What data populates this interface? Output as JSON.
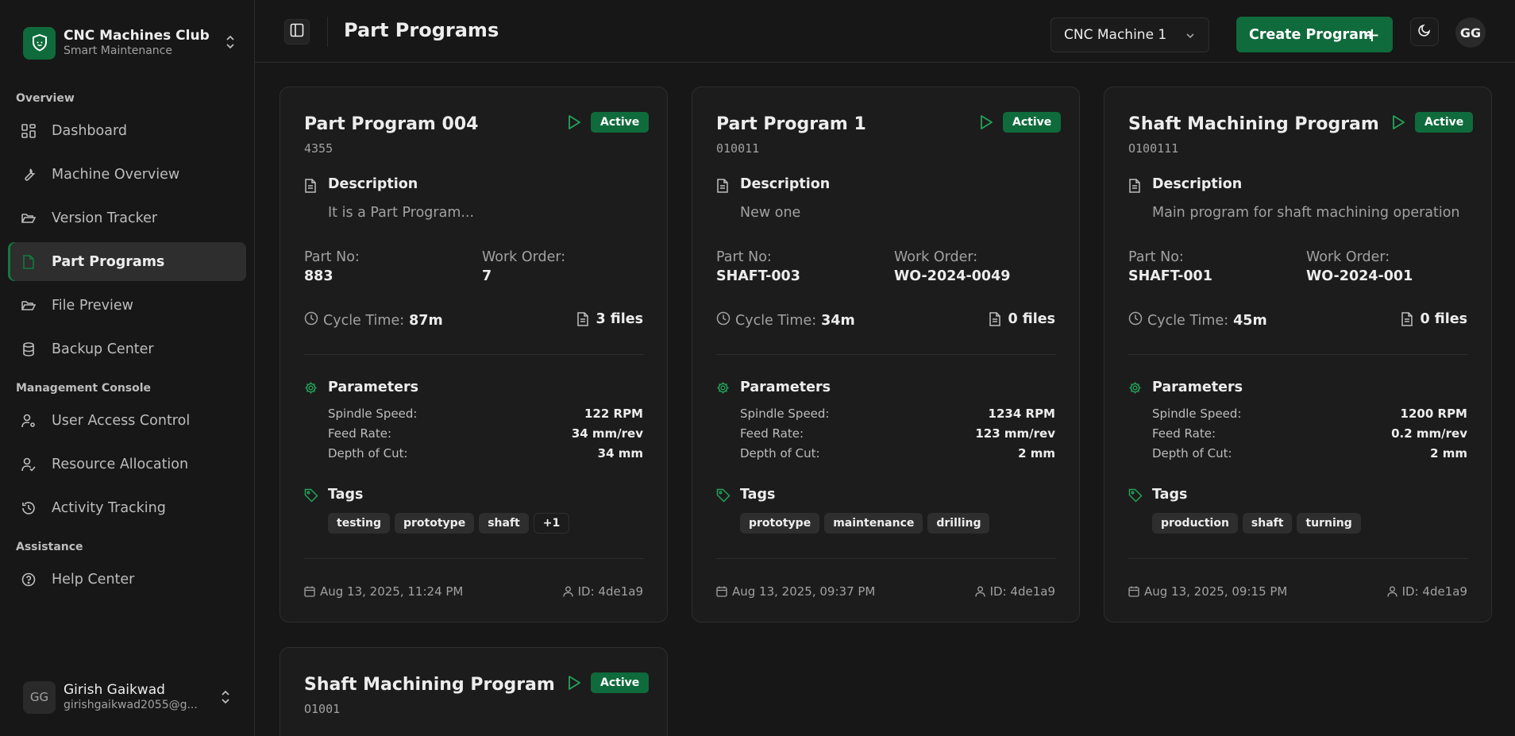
{
  "brand": {
    "title": "CNC Machines Club",
    "subtitle": "Smart Maintenance"
  },
  "sidebar": {
    "sections": [
      "Overview",
      "Management Console",
      "Assistance"
    ],
    "items": [
      {
        "label": "Dashboard",
        "icon": "grid-icon"
      },
      {
        "label": "Machine Overview",
        "icon": "wrench-icon"
      },
      {
        "label": "Version Tracker",
        "icon": "folder-open-icon"
      },
      {
        "label": "Part Programs",
        "icon": "file-icon",
        "active": true
      },
      {
        "label": "File Preview",
        "icon": "folder-open-icon"
      },
      {
        "label": "Backup Center",
        "icon": "database-icon"
      },
      {
        "label": "User Access Control",
        "icon": "user-cog-icon"
      },
      {
        "label": "Resource Allocation",
        "icon": "user-check-icon"
      },
      {
        "label": "Activity Tracking",
        "icon": "history-icon"
      },
      {
        "label": "Help Center",
        "icon": "help-circle-icon"
      }
    ]
  },
  "user": {
    "initials": "GG",
    "name": "Girish Gaikwad",
    "email": "girishgaikwad2055@g..."
  },
  "header": {
    "title": "Part Programs",
    "machine_select": "CNC Machine 1",
    "create_label": "Create Program",
    "avatar_initials": "GG"
  },
  "labels": {
    "description": "Description",
    "part_no": "Part No:",
    "work_order": "Work Order:",
    "cycle_time": "Cycle Time:",
    "parameters": "Parameters",
    "spindle_speed": "Spindle Speed:",
    "feed_rate": "Feed Rate:",
    "depth_of_cut": "Depth of Cut:",
    "tags": "Tags"
  },
  "programs": [
    {
      "title": "Part Program 004",
      "code": "4355",
      "status": "Active",
      "description": "It is a Part Program...",
      "part_no": "883",
      "work_order": "7",
      "cycle_time": "87m",
      "files": "3 files",
      "spindle_speed": "122 RPM",
      "feed_rate": "34 mm/rev",
      "depth_of_cut": "34 mm",
      "tags": [
        "testing",
        "prototype",
        "shaft",
        "+1"
      ],
      "date": "Aug 13, 2025, 11:24 PM",
      "id": "ID: 4de1a9"
    },
    {
      "title": "Part Program 1",
      "code": "010011",
      "status": "Active",
      "description": "New one",
      "part_no": "SHAFT-003",
      "work_order": "WO-2024-0049",
      "cycle_time": "34m",
      "files": "0 files",
      "spindle_speed": "1234 RPM",
      "feed_rate": "123 mm/rev",
      "depth_of_cut": "2 mm",
      "tags": [
        "prototype",
        "maintenance",
        "drilling"
      ],
      "date": "Aug 13, 2025, 09:37 PM",
      "id": "ID: 4de1a9"
    },
    {
      "title": "Shaft Machining Program",
      "code": "O100111",
      "status": "Active",
      "description": "Main program for shaft machining operation",
      "part_no": "SHAFT-001",
      "work_order": "WO-2024-001",
      "cycle_time": "45m",
      "files": "0 files",
      "spindle_speed": "1200 RPM",
      "feed_rate": "0.2 mm/rev",
      "depth_of_cut": "2 mm",
      "tags": [
        "production",
        "shaft",
        "turning"
      ],
      "date": "Aug 13, 2025, 09:15 PM",
      "id": "ID: 4de1a9"
    },
    {
      "title": "Shaft Machining Program",
      "code": "O1001",
      "status": "Active"
    }
  ],
  "colors": {
    "accent": "#0f6b3b",
    "accent_icon": "#22a35a",
    "background": "#171717",
    "card": "#1c1c1c"
  }
}
